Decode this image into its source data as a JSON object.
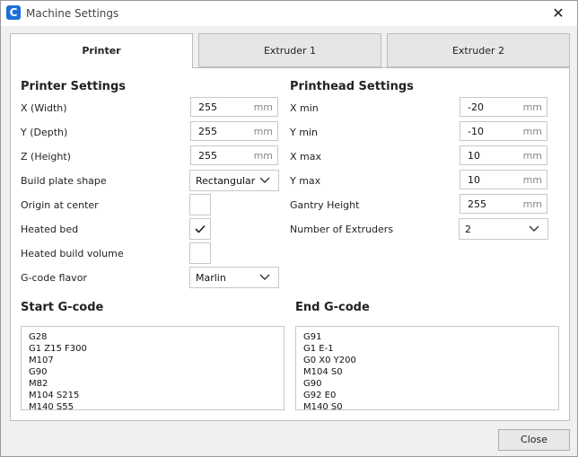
{
  "window": {
    "title": "Machine Settings",
    "app_icon_letter": "C"
  },
  "tabs": [
    {
      "label": "Printer",
      "active": true
    },
    {
      "label": "Extruder 1",
      "active": false
    },
    {
      "label": "Extruder 2",
      "active": false
    }
  ],
  "printer_settings": {
    "title": "Printer Settings",
    "x_width": {
      "label": "X (Width)",
      "value": "255",
      "unit": "mm"
    },
    "y_depth": {
      "label": "Y (Depth)",
      "value": "255",
      "unit": "mm"
    },
    "z_height": {
      "label": "Z (Height)",
      "value": "255",
      "unit": "mm"
    },
    "build_plate_shape": {
      "label": "Build plate shape",
      "value": "Rectangular"
    },
    "origin_at_center": {
      "label": "Origin at center",
      "checked": false
    },
    "heated_bed": {
      "label": "Heated bed",
      "checked": true
    },
    "heated_build_volume": {
      "label": "Heated build volume",
      "checked": false
    },
    "gcode_flavor": {
      "label": "G-code flavor",
      "value": "Marlin"
    }
  },
  "printhead_settings": {
    "title": "Printhead Settings",
    "x_min": {
      "label": "X min",
      "value": "-20",
      "unit": "mm"
    },
    "y_min": {
      "label": "Y min",
      "value": "-10",
      "unit": "mm"
    },
    "x_max": {
      "label": "X max",
      "value": "10",
      "unit": "mm"
    },
    "y_max": {
      "label": "Y max",
      "value": "10",
      "unit": "mm"
    },
    "gantry_height": {
      "label": "Gantry Height",
      "value": "255",
      "unit": "mm"
    },
    "number_of_extruders": {
      "label": "Number of Extruders",
      "value": "2"
    }
  },
  "start_gcode": {
    "title": "Start G-code",
    "lines": [
      "G28",
      "G1 Z15 F300",
      "M107",
      "G90",
      "M82",
      "M104 S215",
      "M140 S55"
    ]
  },
  "end_gcode": {
    "title": "End G-code",
    "lines": [
      "G91",
      "G1 E-1",
      "G0 X0 Y200",
      "M104 S0",
      "G90",
      "G92 E0",
      "M140 S0"
    ]
  },
  "footer": {
    "close_label": "Close"
  },
  "colors": {
    "accent": "#1c6fd6",
    "panel_bg": "#ffffff",
    "window_bg": "#f0f0f0"
  }
}
